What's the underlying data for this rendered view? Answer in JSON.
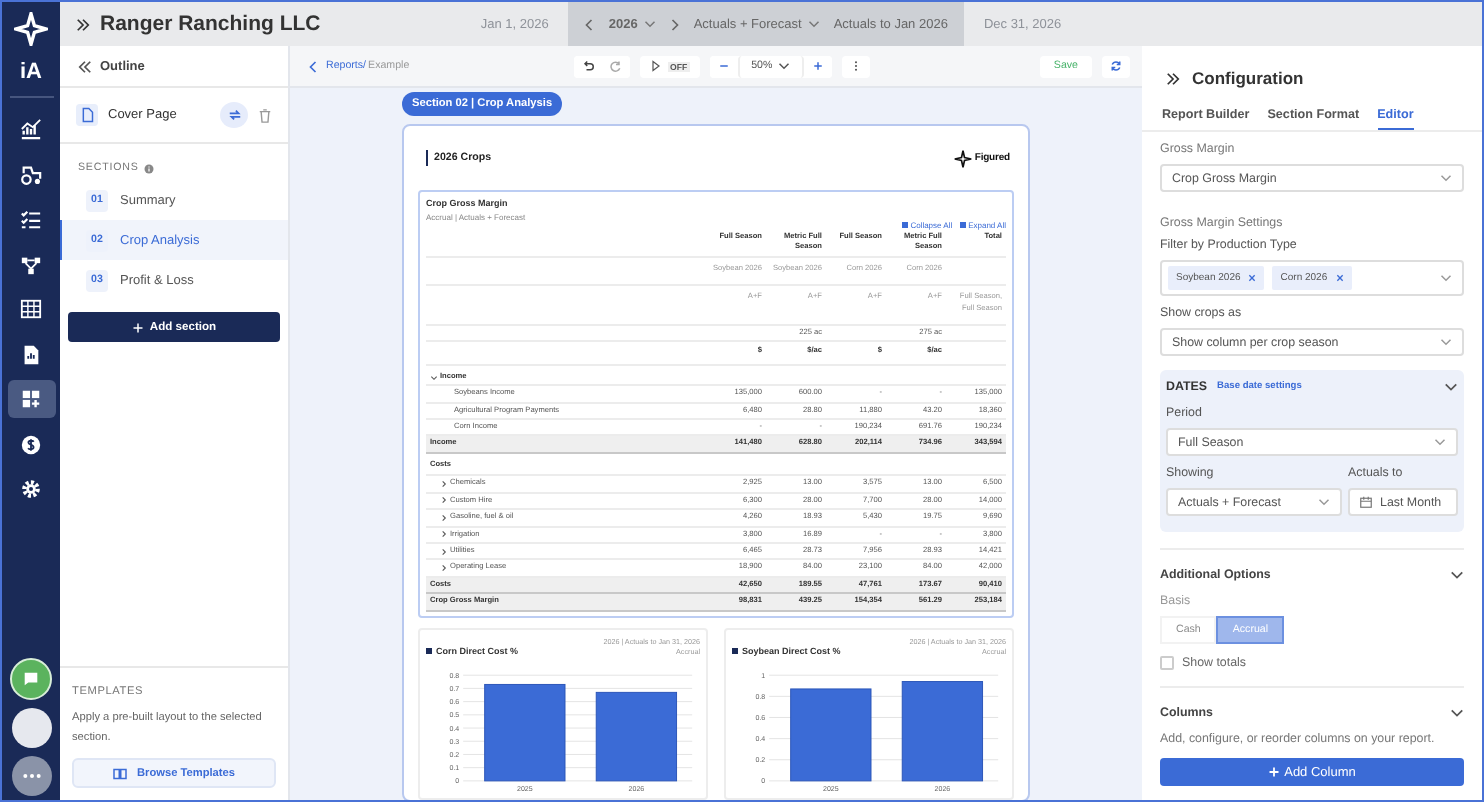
{
  "rail": {
    "brand": "iA",
    "items": [
      {
        "kind": "chart",
        "selected": false
      },
      {
        "kind": "tractor",
        "selected": false
      },
      {
        "kind": "checklist",
        "selected": false
      },
      {
        "kind": "network",
        "selected": false
      },
      {
        "kind": "grid",
        "selected": false
      },
      {
        "kind": "document",
        "selected": false
      },
      {
        "kind": "dashboard",
        "selected": true
      },
      {
        "kind": "dollar",
        "selected": false
      },
      {
        "kind": "settings",
        "selected": false
      }
    ]
  },
  "top_bar": {
    "company": "Ranger Ranching LLC",
    "start_date": "Jan 1, 2026",
    "year": "2026",
    "mode": "Actuals + Forecast",
    "actuals_to": "Actuals to Jan 2026",
    "end_date": "Dec 31, 2026"
  },
  "outline": {
    "title": "Outline",
    "cover_page": "Cover Page",
    "sections_label": "SECTIONS",
    "sections": [
      {
        "number": "01",
        "name": "Summary",
        "selected": false
      },
      {
        "number": "02",
        "name": "Crop Analysis",
        "selected": true
      },
      {
        "number": "03",
        "name": "Profit & Loss",
        "selected": false
      }
    ],
    "add_section": "Add section",
    "templates": {
      "title": "TEMPLATES",
      "description": "Apply a pre-built layout to the selected section.",
      "button": "Browse Templates"
    }
  },
  "toolbar": {
    "breadcrumb_link": "Reports/",
    "breadcrumb_current": "Example",
    "preview_toggle": "OFF",
    "zoom": "50%",
    "save": "Save"
  },
  "report": {
    "section_tag": "Section 02 | Crop Analysis",
    "title": "2026 Crops",
    "brand": "Figured",
    "table": {
      "title": "Crop Gross Margin",
      "subtitle": "Accrual | Actuals + Forecast",
      "collapse_all": "Collapse All",
      "expand_all": "Expand All",
      "header_rows": [
        [
          "Full Season",
          "Metric Full Season",
          "Full Season",
          "Metric Full Season",
          "Total"
        ],
        [
          "Soybean 2026",
          "Soybean 2026",
          "Corn 2026",
          "Corn 2026",
          null
        ],
        [
          "A+F",
          "A+F",
          "A+F",
          "A+F",
          "Full Season, Full Season"
        ],
        [
          null,
          "225 ac",
          null,
          "275 ac",
          null
        ],
        [
          "$",
          "$/ac",
          "$",
          "$/ac",
          null
        ]
      ],
      "rows": [
        {
          "kind": "group",
          "label": "Income",
          "expanded": true
        },
        {
          "kind": "item",
          "label": "Soybeans Income",
          "values": [
            "135,000",
            "600.00",
            "-",
            "-",
            "135,000"
          ]
        },
        {
          "kind": "item",
          "label": "Agricultural Program Payments",
          "values": [
            "6,480",
            "28.80",
            "11,880",
            "43.20",
            "18,360"
          ]
        },
        {
          "kind": "item",
          "label": "Corn Income",
          "values": [
            "-",
            "-",
            "190,234",
            "691.76",
            "190,234"
          ]
        },
        {
          "kind": "total",
          "label": "Income",
          "values": [
            "141,480",
            "628.80",
            "202,114",
            "734.96",
            "343,594"
          ]
        },
        {
          "kind": "heading",
          "label": "Costs"
        },
        {
          "kind": "subgroup",
          "label": "Chemicals",
          "expanded": false,
          "values": [
            "2,925",
            "13.00",
            "3,575",
            "13.00",
            "6,500"
          ]
        },
        {
          "kind": "subgroup",
          "label": "Custom Hire",
          "expanded": false,
          "values": [
            "6,300",
            "28.00",
            "7,700",
            "28.00",
            "14,000"
          ]
        },
        {
          "kind": "subgroup",
          "label": "Gasoline, fuel & oil",
          "expanded": false,
          "values": [
            "4,260",
            "18.93",
            "5,430",
            "19.75",
            "9,690"
          ]
        },
        {
          "kind": "subgroup",
          "label": "Irrigation",
          "expanded": false,
          "values": [
            "3,800",
            "16.89",
            "-",
            "-",
            "3,800"
          ]
        },
        {
          "kind": "subgroup",
          "label": "Utilities",
          "expanded": false,
          "values": [
            "6,465",
            "28.73",
            "7,956",
            "28.93",
            "14,421"
          ]
        },
        {
          "kind": "subgroup",
          "label": "Operating Lease",
          "expanded": false,
          "values": [
            "18,900",
            "84.00",
            "23,100",
            "84.00",
            "42,000"
          ]
        },
        {
          "kind": "total",
          "label": "Costs",
          "values": [
            "42,650",
            "189.55",
            "47,761",
            "173.67",
            "90,410"
          ]
        },
        {
          "kind": "total",
          "label": "Crop Gross Margin",
          "values": [
            "98,831",
            "439.25",
            "154,354",
            "561.29",
            "253,184"
          ]
        }
      ]
    },
    "charts": [
      {
        "period": "2026 | Actuals to Jan 31, 2026",
        "basis": "Accrual",
        "chart_data": {
          "type": "bar",
          "title": "Corn Direct Cost %",
          "categories": [
            "2025",
            "2026"
          ],
          "values": [
            0.73,
            0.67
          ],
          "ylim": [
            0,
            0.8
          ],
          "grid": true,
          "yticks": [
            0,
            0.1,
            0.2,
            0.3,
            0.4,
            0.5,
            0.6,
            0.7,
            0.8
          ]
        }
      },
      {
        "period": "2026 | Actuals to Jan 31, 2026",
        "basis": "Accrual",
        "chart_data": {
          "type": "bar",
          "title": "Soybean Direct Cost %",
          "categories": [
            "2025",
            "2026"
          ],
          "values": [
            0.87,
            0.94
          ],
          "ylim": [
            0,
            1
          ],
          "grid": true,
          "yticks": [
            0,
            0.2,
            0.4,
            0.6,
            0.8,
            1
          ]
        }
      }
    ]
  },
  "config": {
    "title": "Configuration",
    "tabs": [
      {
        "label": "Report Builder",
        "selected": false
      },
      {
        "label": "Section Format",
        "selected": false
      },
      {
        "label": "Editor",
        "selected": true
      }
    ],
    "gross_margin": {
      "label": "Gross Margin",
      "value": "Crop Gross Margin"
    },
    "settings_label": "Gross Margin Settings",
    "filter": {
      "label": "Filter by Production Type",
      "tags": [
        "Soybean 2026",
        "Corn 2026"
      ]
    },
    "show_crops": {
      "label": "Show crops as",
      "value": "Show column per crop season"
    },
    "dates": {
      "title": "DATES",
      "link": "Base date settings",
      "period": {
        "label": "Period",
        "value": "Full Season"
      },
      "showing": {
        "label": "Showing",
        "value": "Actuals + Forecast"
      },
      "actuals_to": {
        "label": "Actuals to",
        "value": "Last Month"
      }
    },
    "additional": {
      "title": "Additional Options",
      "basis_label": "Basis",
      "disabled": true,
      "basis_options": [
        {
          "label": "Cash",
          "selected": false
        },
        {
          "label": "Accrual",
          "selected": true
        }
      ],
      "show_totals": {
        "label": "Show totals",
        "checked": false
      }
    },
    "columns": {
      "title": "Columns",
      "description": "Add, configure, or reorder columns on your report.",
      "button": "Add Column"
    }
  }
}
